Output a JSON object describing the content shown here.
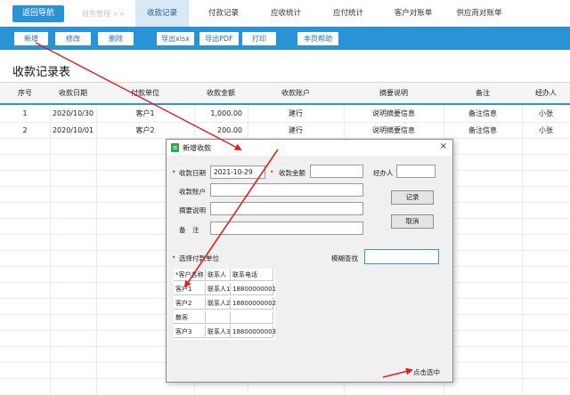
{
  "nav": {
    "back_label": "返回导航",
    "breadcrumb": "财务管理 >>",
    "tabs": [
      "收款记录",
      "付款记录",
      "应收统计",
      "应付统计",
      "客户对账单",
      "供应商对账单"
    ]
  },
  "toolbar": {
    "add": "新增",
    "edit": "修改",
    "delete": "删除",
    "export_xlsx": "导出xlsx",
    "export_pdf": "导出PDF",
    "print": "打印",
    "help": "本页帮助"
  },
  "page_title": "收款记录表",
  "table": {
    "headers": [
      "序号",
      "收款日期",
      "付款单位",
      "收款金额",
      "收款账户",
      "摘要说明",
      "备注",
      "经办人"
    ],
    "rows": [
      [
        "1",
        "2020/10/30",
        "客户1",
        "1,000.00",
        "建行",
        "说明摘要信息",
        "备注信息",
        "小张"
      ],
      [
        "2",
        "2020/10/01",
        "客户2",
        "200.00",
        "建行",
        "说明摘要信息",
        "备注信息",
        "小张"
      ]
    ]
  },
  "dialog": {
    "title": "新增收款",
    "close": "×",
    "date_label": "收款日期",
    "date_value": "2021-10-29",
    "amount_label": "收款金额",
    "handler_label": "经办人",
    "account_label": "收款账户",
    "summary_label": "摘要说明",
    "remark_label": "备　注",
    "record_button": "记录",
    "cancel_button": "取消",
    "select_payer_label": "选择付款单位",
    "fuzzy_search_label": "模糊查找",
    "grid_headers": [
      "*客户名称",
      "联系人",
      "联系电话"
    ],
    "grid_rows": [
      [
        "客户1",
        "联系人1",
        "18800000001"
      ],
      [
        "客户2",
        "联系人2",
        "18800000002"
      ],
      [
        "散客",
        "",
        ""
      ],
      [
        "客户3",
        "联系人3",
        "18800000003"
      ]
    ],
    "status_text": "点击选中"
  },
  "colors": {
    "accent": "#2a93d5",
    "active_tab": "#d8e8f4",
    "arrow": "#e02020"
  }
}
